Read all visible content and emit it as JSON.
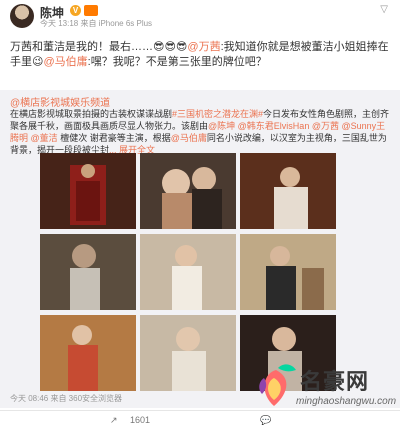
{
  "post": {
    "author": "陈坤",
    "time_device": "今天 13:18 来自 iPhone 6s Plus",
    "text_1": "万茜和董洁是我的！最右……",
    "text_emoji": "😎😎😎",
    "mention_1": "@万茜",
    "text_2": ":我知道你就是想被董洁小姐姐捧在手里",
    "mention_2": "@马伯庸",
    "text_3": ":嘿？我呢？不是第三张里的牌位吧？"
  },
  "repost": {
    "source": "@横店影视城娱乐频道",
    "body_1": "在横店影视城取景拍摄的古装权谋谍战剧",
    "topic": "#三国机密之潜龙在渊#",
    "body_2": "今日发布女性角色剧照，主创齐聚各展千秋，画面极具画质尽显人物张力。该剧由",
    "m1": "@陈坤",
    "m2": "@韩东君ElvisHan",
    "m3": "@万茜",
    "m4": "@Sunny王腾明",
    "m5": "@董洁",
    "body_3": "檀健次 谢君豪等主演，根据",
    "m6": "@马伯庸",
    "body_4": "同名小说改编，以汉室为主视角，三国乱世为背景，揭开一段段被尘封",
    "more": "... 展开全文",
    "time_device": "今天 08:46 来自 360安全浏览器"
  },
  "actions": {
    "share_count": "1601"
  },
  "watermark": {
    "name": "名豪网",
    "url": "minghaoshangwu.com"
  },
  "icons": [
    "v-badge-icon",
    "chevron-down-icon",
    "share-icon",
    "comment-icon"
  ]
}
